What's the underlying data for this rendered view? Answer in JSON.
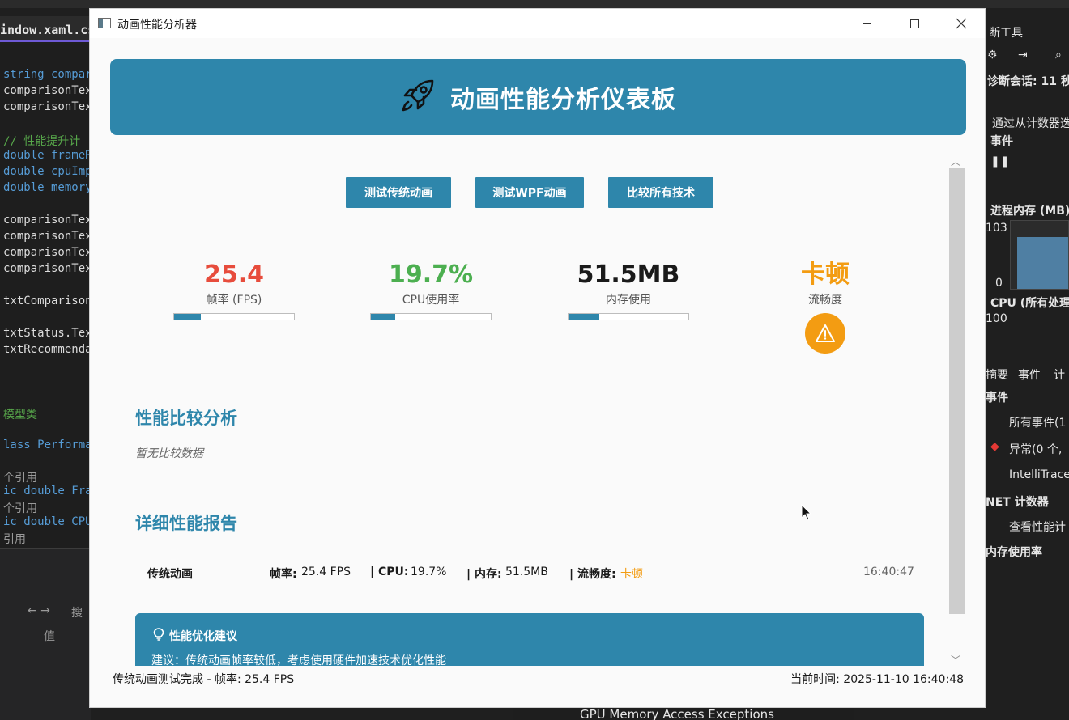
{
  "ide": {
    "tab": "indow.xaml.cs",
    "code_lines": [
      {
        "t": "string compar",
        "c": "kw"
      },
      {
        "t": "comparisonTex",
        "c": "tx"
      },
      {
        "t": "comparisonTex",
        "c": "tx"
      },
      {
        "t": "// 性能提升计",
        "c": "cm"
      },
      {
        "t": "double frameR",
        "c": "kw"
      },
      {
        "t": "double cpuImp",
        "c": "kw"
      },
      {
        "t": "double memory",
        "c": "kw"
      },
      {
        "t": "comparisonTex",
        "c": "tx"
      },
      {
        "t": "comparisonTex",
        "c": "tx"
      },
      {
        "t": "comparisonTex",
        "c": "tx"
      },
      {
        "t": "comparisonTex",
        "c": "tx"
      },
      {
        "t": "txtComparison",
        "c": "tx"
      },
      {
        "t": "txtStatus.Tex",
        "c": "tx"
      },
      {
        "t": "txtRecommenda",
        "c": "tx"
      },
      {
        "t": "模型类",
        "c": "cm"
      },
      {
        "t": "lass Performa",
        "c": "kw"
      },
      {
        "t": "个引用",
        "c": "gr"
      },
      {
        "t": "ic double Fra",
        "c": "kw"
      },
      {
        "t": "个引用",
        "c": "gr"
      },
      {
        "t": "ic double CPU",
        "c": "kw"
      },
      {
        "t": "引用",
        "c": "gr"
      }
    ],
    "bottom_search": "搜",
    "bottom_value_header": "值",
    "right_panel": {
      "title": "断工具",
      "session": "诊断会话: 11 秒",
      "counter_hint": "通过从计数器选",
      "events": "事件",
      "proc_mem": "进程内存 (MB)",
      "mem_max": "103",
      "mem_min": "0",
      "cpu": "CPU (所有处理",
      "cpu_max": "100",
      "tabs": [
        "摘要",
        "事件",
        "计"
      ],
      "events_header": "事件",
      "all_events": "所有事件(1",
      "exceptions": "异常(0 个,",
      "intellitrace": "IntelliTrace",
      "net_counters": "NET 计数器",
      "view_perf": "查看性能计",
      "mem_usage": "内存使用率"
    },
    "gpu_row": "GPU Memory Access Exceptions"
  },
  "window": {
    "title": "动画性能分析器",
    "header": "动画性能分析仪表板",
    "buttons": {
      "legacy": "测试传统动画",
      "wpf": "测试WPF动画",
      "compare": "比较所有技术"
    },
    "metrics": {
      "fps": {
        "value": "25.4",
        "label": "帧率 (FPS)",
        "color": "#e74c3c",
        "fill": 0.22
      },
      "cpu": {
        "value": "19.7%",
        "label": "CPU使用率",
        "color": "#4caf50",
        "fill": 0.2
      },
      "memory": {
        "value": "51.5MB",
        "label": "内存使用",
        "color": "#1a1a1a",
        "fill": 0.26
      },
      "smoothness": {
        "value": "卡顿",
        "label": "流畅度",
        "color": "#f39c12",
        "icon": "warning-icon"
      }
    },
    "comparison": {
      "title": "性能比较分析",
      "empty": "暂无比较数据"
    },
    "report": {
      "title": "详细性能报告",
      "row": {
        "name": "传统动画",
        "fps_label": "帧率:",
        "fps_value": "25.4 FPS",
        "cpu_label": "| CPU:",
        "cpu_value": "19.7%",
        "mem_label": "| 内存:",
        "mem_value": "51.5MB",
        "smooth_label": "| 流畅度:",
        "smooth_value": "卡顿",
        "time": "16:40:47"
      }
    },
    "tips": {
      "title": "性能优化建议",
      "text": "建议：传统动画帧率较低，考虑使用硬件加速技术优化性能"
    },
    "status": {
      "left": "传统动画测试完成 - 帧率: 25.4 FPS",
      "right": "当前时间: 2025-11-10 16:40:48"
    },
    "accent": "#2e86ab"
  }
}
